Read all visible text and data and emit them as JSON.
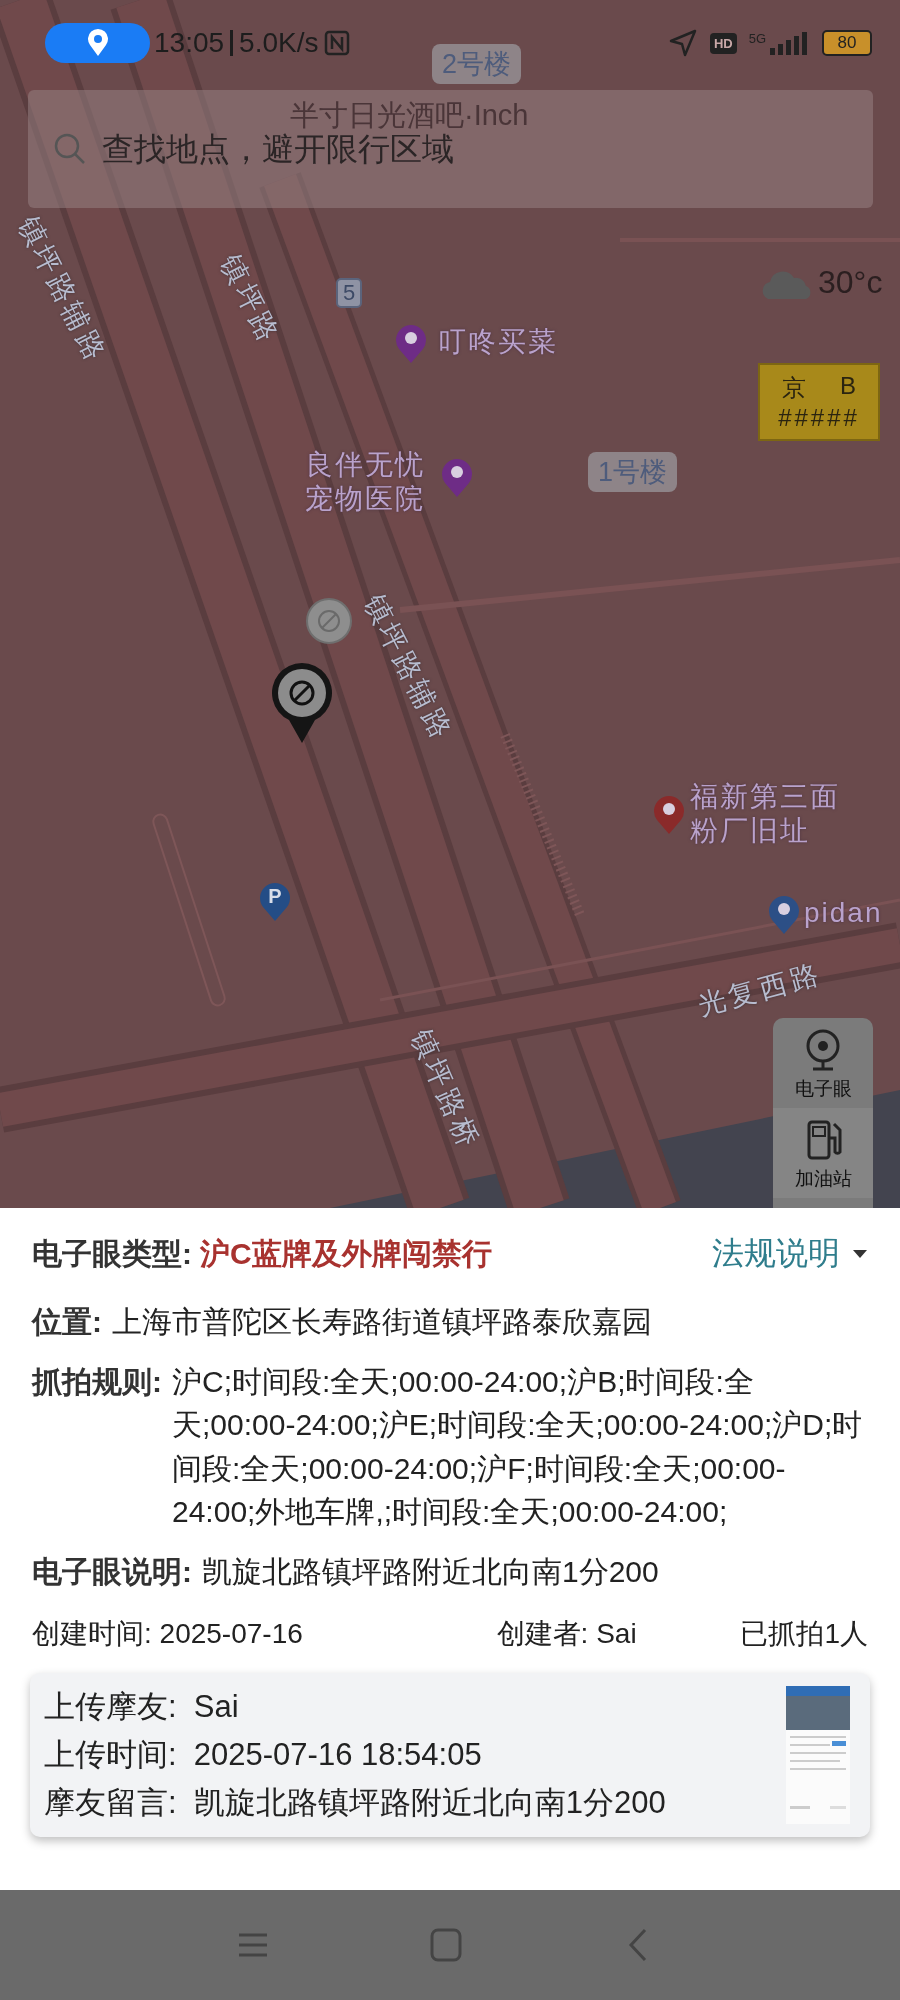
{
  "status_bar": {
    "time": "13:05",
    "speed": "5.0K/s",
    "hd": "HD",
    "network": "5G",
    "battery": "80"
  },
  "search": {
    "placeholder": "查找地点，避开限行区域"
  },
  "map": {
    "labels": [
      {
        "kind": "chip",
        "text": "2号楼"
      },
      {
        "kind": "faded",
        "text": "半寸日光酒吧·Inch"
      },
      {
        "kind": "road",
        "text": "镇坪路辅路"
      },
      {
        "kind": "road",
        "text": "镇坪路"
      },
      {
        "kind": "shield",
        "text": "5"
      },
      {
        "kind": "chip",
        "text": "1号楼"
      },
      {
        "kind": "road",
        "text": "镇坪路辅路"
      },
      {
        "kind": "road",
        "text": "光复西路"
      },
      {
        "kind": "road",
        "text": "镇坪路桥"
      }
    ],
    "pois": [
      {
        "name": "叮咚买菜",
        "color": "#6e2c86"
      },
      {
        "name": "良伴无忧宠物医院",
        "color": "#6e2c86"
      },
      {
        "name": "福新第三面粉厂旧址",
        "color": "#8a2a2a"
      },
      {
        "name": "pidan",
        "color": "#2c4f86"
      }
    ],
    "parking": {
      "glyph": "P"
    },
    "weather": "30°c",
    "plate": {
      "province": "京",
      "letter": "B",
      "number": "#####"
    },
    "tools": [
      {
        "kind": "camera",
        "label": "电子眼"
      },
      {
        "kind": "fuel",
        "label": "加油站"
      }
    ]
  },
  "panel": {
    "type_label": "电子眼类型:",
    "type_value": "沪C蓝牌及外牌闯禁行",
    "rules_link": "法规说明",
    "fields": [
      {
        "label": "位置:",
        "value": "上海市普陀区长寿路街道镇坪路泰欣嘉园"
      },
      {
        "label": "抓拍规则:",
        "value": "沪C;时间段:全天;00:00-24:00;沪B;时间段:全天;00:00-24:00;沪E;时间段:全天;00:00-24:00;沪D;时间段:全天;00:00-24:00;沪F;时间段:全天;00:00-24:00;外地车牌,;时间段:全天;00:00-24:00;"
      },
      {
        "label": "电子眼说明:",
        "value": "凯旋北路镇坪路附近北向南1分200"
      }
    ],
    "meta": [
      "创建时间: 2025-07-16",
      "创建者: Sai",
      "已抓拍1人"
    ],
    "upload": [
      {
        "label": "上传摩友:",
        "value": "Sai"
      },
      {
        "label": "上传时间:",
        "value": "2025-07-16 18:54:05"
      },
      {
        "label": "摩友留言:",
        "value": "凯旋北路镇坪路附近北向南1分200"
      }
    ]
  }
}
